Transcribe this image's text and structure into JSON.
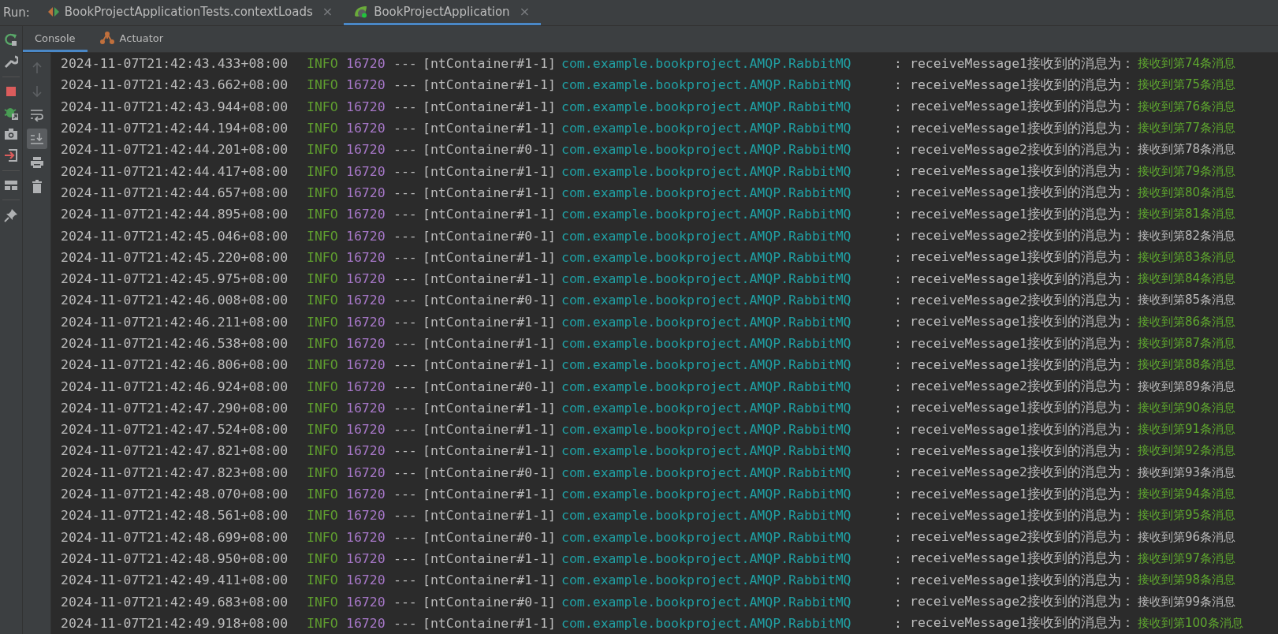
{
  "run_bar": {
    "label": "Run:",
    "tabs": [
      {
        "kind": "test",
        "label": "BookProjectApplicationTests.contextLoads",
        "selected": false,
        "close": "×"
      },
      {
        "kind": "spring",
        "label": "BookProjectApplication",
        "selected": true,
        "close": "×"
      }
    ]
  },
  "side_toolbar": [
    {
      "kind": "rerun"
    },
    {
      "kind": "wrench"
    },
    {
      "kind": "stop"
    },
    {
      "kind": "debug"
    },
    {
      "kind": "camera"
    },
    {
      "kind": "exit"
    },
    {
      "kind": "layout"
    },
    {
      "kind": "pin"
    }
  ],
  "console_tabs": [
    {
      "kind": "console",
      "label": "Console",
      "selected": true
    },
    {
      "kind": "actuator",
      "label": "Actuator",
      "selected": false
    }
  ],
  "console_toolbar": [
    {
      "kind": "up",
      "disabled": true,
      "on": false
    },
    {
      "kind": "down",
      "disabled": true,
      "on": false
    },
    {
      "kind": "wrap",
      "disabled": false,
      "on": false
    },
    {
      "kind": "scroll_end",
      "disabled": false,
      "on": true
    },
    {
      "kind": "print",
      "disabled": false,
      "on": false
    },
    {
      "kind": "clear",
      "disabled": false,
      "on": false
    }
  ],
  "log": [
    {
      "time": "2024-11-07T21:42:43.433+08:00",
      "level": "INFO",
      "pid": "16720",
      "sep": "---",
      "thread": "[ntContainer#1-1]",
      "logger": "com.example.bookproject.AMQP.RabbitMQ",
      "colon": ":",
      "message": "receiveMessage1接收到的消息为：",
      "body": "接收到第74条消息",
      "highlighted": true
    },
    {
      "time": "2024-11-07T21:42:43.662+08:00",
      "level": "INFO",
      "pid": "16720",
      "sep": "---",
      "thread": "[ntContainer#1-1]",
      "logger": "com.example.bookproject.AMQP.RabbitMQ",
      "colon": ":",
      "message": "receiveMessage1接收到的消息为：",
      "body": "接收到第75条消息",
      "highlighted": true
    },
    {
      "time": "2024-11-07T21:42:43.944+08:00",
      "level": "INFO",
      "pid": "16720",
      "sep": "---",
      "thread": "[ntContainer#1-1]",
      "logger": "com.example.bookproject.AMQP.RabbitMQ",
      "colon": ":",
      "message": "receiveMessage1接收到的消息为：",
      "body": "接收到第76条消息",
      "highlighted": true
    },
    {
      "time": "2024-11-07T21:42:44.194+08:00",
      "level": "INFO",
      "pid": "16720",
      "sep": "---",
      "thread": "[ntContainer#1-1]",
      "logger": "com.example.bookproject.AMQP.RabbitMQ",
      "colon": ":",
      "message": "receiveMessage1接收到的消息为：",
      "body": "接收到第77条消息",
      "highlighted": true
    },
    {
      "time": "2024-11-07T21:42:44.201+08:00",
      "level": "INFO",
      "pid": "16720",
      "sep": "---",
      "thread": "[ntContainer#0-1]",
      "logger": "com.example.bookproject.AMQP.RabbitMQ",
      "colon": ":",
      "message": "receiveMessage2接收到的消息为：",
      "body": "接收到第78条消息",
      "highlighted": false
    },
    {
      "time": "2024-11-07T21:42:44.417+08:00",
      "level": "INFO",
      "pid": "16720",
      "sep": "---",
      "thread": "[ntContainer#1-1]",
      "logger": "com.example.bookproject.AMQP.RabbitMQ",
      "colon": ":",
      "message": "receiveMessage1接收到的消息为：",
      "body": "接收到第79条消息",
      "highlighted": true
    },
    {
      "time": "2024-11-07T21:42:44.657+08:00",
      "level": "INFO",
      "pid": "16720",
      "sep": "---",
      "thread": "[ntContainer#1-1]",
      "logger": "com.example.bookproject.AMQP.RabbitMQ",
      "colon": ":",
      "message": "receiveMessage1接收到的消息为：",
      "body": "接收到第80条消息",
      "highlighted": true
    },
    {
      "time": "2024-11-07T21:42:44.895+08:00",
      "level": "INFO",
      "pid": "16720",
      "sep": "---",
      "thread": "[ntContainer#1-1]",
      "logger": "com.example.bookproject.AMQP.RabbitMQ",
      "colon": ":",
      "message": "receiveMessage1接收到的消息为：",
      "body": "接收到第81条消息",
      "highlighted": true
    },
    {
      "time": "2024-11-07T21:42:45.046+08:00",
      "level": "INFO",
      "pid": "16720",
      "sep": "---",
      "thread": "[ntContainer#0-1]",
      "logger": "com.example.bookproject.AMQP.RabbitMQ",
      "colon": ":",
      "message": "receiveMessage2接收到的消息为：",
      "body": "接收到第82条消息",
      "highlighted": false
    },
    {
      "time": "2024-11-07T21:42:45.220+08:00",
      "level": "INFO",
      "pid": "16720",
      "sep": "---",
      "thread": "[ntContainer#1-1]",
      "logger": "com.example.bookproject.AMQP.RabbitMQ",
      "colon": ":",
      "message": "receiveMessage1接收到的消息为：",
      "body": "接收到第83条消息",
      "highlighted": true
    },
    {
      "time": "2024-11-07T21:42:45.975+08:00",
      "level": "INFO",
      "pid": "16720",
      "sep": "---",
      "thread": "[ntContainer#1-1]",
      "logger": "com.example.bookproject.AMQP.RabbitMQ",
      "colon": ":",
      "message": "receiveMessage1接收到的消息为：",
      "body": "接收到第84条消息",
      "highlighted": true
    },
    {
      "time": "2024-11-07T21:42:46.008+08:00",
      "level": "INFO",
      "pid": "16720",
      "sep": "---",
      "thread": "[ntContainer#0-1]",
      "logger": "com.example.bookproject.AMQP.RabbitMQ",
      "colon": ":",
      "message": "receiveMessage2接收到的消息为：",
      "body": "接收到第85条消息",
      "highlighted": false
    },
    {
      "time": "2024-11-07T21:42:46.211+08:00",
      "level": "INFO",
      "pid": "16720",
      "sep": "---",
      "thread": "[ntContainer#1-1]",
      "logger": "com.example.bookproject.AMQP.RabbitMQ",
      "colon": ":",
      "message": "receiveMessage1接收到的消息为：",
      "body": "接收到第86条消息",
      "highlighted": true
    },
    {
      "time": "2024-11-07T21:42:46.538+08:00",
      "level": "INFO",
      "pid": "16720",
      "sep": "---",
      "thread": "[ntContainer#1-1]",
      "logger": "com.example.bookproject.AMQP.RabbitMQ",
      "colon": ":",
      "message": "receiveMessage1接收到的消息为：",
      "body": "接收到第87条消息",
      "highlighted": true
    },
    {
      "time": "2024-11-07T21:42:46.806+08:00",
      "level": "INFO",
      "pid": "16720",
      "sep": "---",
      "thread": "[ntContainer#1-1]",
      "logger": "com.example.bookproject.AMQP.RabbitMQ",
      "colon": ":",
      "message": "receiveMessage1接收到的消息为：",
      "body": "接收到第88条消息",
      "highlighted": true
    },
    {
      "time": "2024-11-07T21:42:46.924+08:00",
      "level": "INFO",
      "pid": "16720",
      "sep": "---",
      "thread": "[ntContainer#0-1]",
      "logger": "com.example.bookproject.AMQP.RabbitMQ",
      "colon": ":",
      "message": "receiveMessage2接收到的消息为：",
      "body": "接收到第89条消息",
      "highlighted": false
    },
    {
      "time": "2024-11-07T21:42:47.290+08:00",
      "level": "INFO",
      "pid": "16720",
      "sep": "---",
      "thread": "[ntContainer#1-1]",
      "logger": "com.example.bookproject.AMQP.RabbitMQ",
      "colon": ":",
      "message": "receiveMessage1接收到的消息为：",
      "body": "接收到第90条消息",
      "highlighted": true
    },
    {
      "time": "2024-11-07T21:42:47.524+08:00",
      "level": "INFO",
      "pid": "16720",
      "sep": "---",
      "thread": "[ntContainer#1-1]",
      "logger": "com.example.bookproject.AMQP.RabbitMQ",
      "colon": ":",
      "message": "receiveMessage1接收到的消息为：",
      "body": "接收到第91条消息",
      "highlighted": true
    },
    {
      "time": "2024-11-07T21:42:47.821+08:00",
      "level": "INFO",
      "pid": "16720",
      "sep": "---",
      "thread": "[ntContainer#1-1]",
      "logger": "com.example.bookproject.AMQP.RabbitMQ",
      "colon": ":",
      "message": "receiveMessage1接收到的消息为：",
      "body": "接收到第92条消息",
      "highlighted": true
    },
    {
      "time": "2024-11-07T21:42:47.823+08:00",
      "level": "INFO",
      "pid": "16720",
      "sep": "---",
      "thread": "[ntContainer#0-1]",
      "logger": "com.example.bookproject.AMQP.RabbitMQ",
      "colon": ":",
      "message": "receiveMessage2接收到的消息为：",
      "body": "接收到第93条消息",
      "highlighted": false
    },
    {
      "time": "2024-11-07T21:42:48.070+08:00",
      "level": "INFO",
      "pid": "16720",
      "sep": "---",
      "thread": "[ntContainer#1-1]",
      "logger": "com.example.bookproject.AMQP.RabbitMQ",
      "colon": ":",
      "message": "receiveMessage1接收到的消息为：",
      "body": "接收到第94条消息",
      "highlighted": true
    },
    {
      "time": "2024-11-07T21:42:48.561+08:00",
      "level": "INFO",
      "pid": "16720",
      "sep": "---",
      "thread": "[ntContainer#1-1]",
      "logger": "com.example.bookproject.AMQP.RabbitMQ",
      "colon": ":",
      "message": "receiveMessage1接收到的消息为：",
      "body": "接收到第95条消息",
      "highlighted": true
    },
    {
      "time": "2024-11-07T21:42:48.699+08:00",
      "level": "INFO",
      "pid": "16720",
      "sep": "---",
      "thread": "[ntContainer#0-1]",
      "logger": "com.example.bookproject.AMQP.RabbitMQ",
      "colon": ":",
      "message": "receiveMessage2接收到的消息为：",
      "body": "接收到第96条消息",
      "highlighted": false
    },
    {
      "time": "2024-11-07T21:42:48.950+08:00",
      "level": "INFO",
      "pid": "16720",
      "sep": "---",
      "thread": "[ntContainer#1-1]",
      "logger": "com.example.bookproject.AMQP.RabbitMQ",
      "colon": ":",
      "message": "receiveMessage1接收到的消息为：",
      "body": "接收到第97条消息",
      "highlighted": true
    },
    {
      "time": "2024-11-07T21:42:49.411+08:00",
      "level": "INFO",
      "pid": "16720",
      "sep": "---",
      "thread": "[ntContainer#1-1]",
      "logger": "com.example.bookproject.AMQP.RabbitMQ",
      "colon": ":",
      "message": "receiveMessage1接收到的消息为：",
      "body": "接收到第98条消息",
      "highlighted": true
    },
    {
      "time": "2024-11-07T21:42:49.683+08:00",
      "level": "INFO",
      "pid": "16720",
      "sep": "---",
      "thread": "[ntContainer#0-1]",
      "logger": "com.example.bookproject.AMQP.RabbitMQ",
      "colon": ":",
      "message": "receiveMessage2接收到的消息为：",
      "body": "接收到第99条消息",
      "highlighted": false
    },
    {
      "time": "2024-11-07T21:42:49.918+08:00",
      "level": "INFO",
      "pid": "16720",
      "sep": "---",
      "thread": "[ntContainer#1-1]",
      "logger": "com.example.bookproject.AMQP.RabbitMQ",
      "colon": ":",
      "message": "receiveMessage1接收到的消息为：",
      "body": "接收到第100条消息",
      "highlighted": true
    }
  ]
}
